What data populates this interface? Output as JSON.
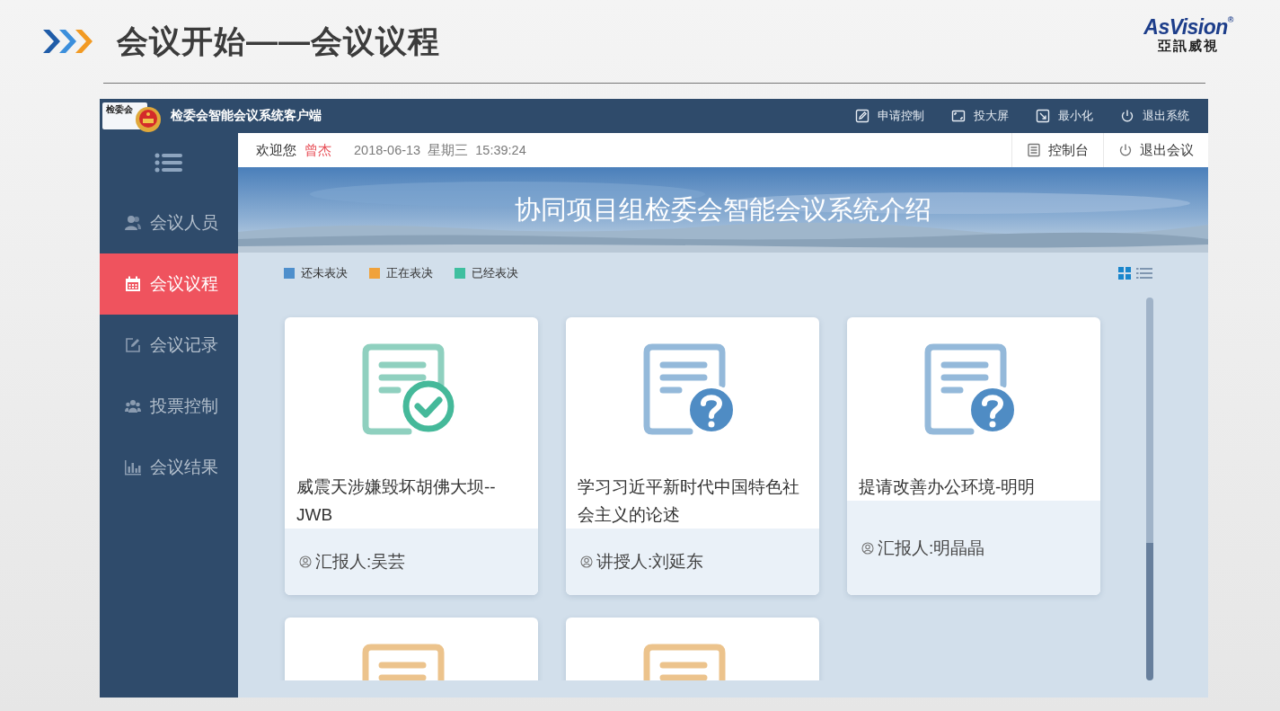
{
  "slide": {
    "title": "会议开始——会议议程",
    "logo": {
      "name": "AsVision",
      "mark": "®",
      "subtitle": "亞訊威視"
    }
  },
  "window": {
    "badge": "检委会",
    "title": "检委会智能会议系统客户端",
    "actions": [
      {
        "kind": "edit",
        "label": "申请控制"
      },
      {
        "kind": "screen",
        "label": "投大屏"
      },
      {
        "kind": "minimize",
        "label": "最小化"
      },
      {
        "kind": "power",
        "label": "退出系统"
      }
    ]
  },
  "sidebar": {
    "items": [
      {
        "kind": "people",
        "label": "会议人员",
        "selected": false
      },
      {
        "kind": "calendar",
        "label": "会议议程",
        "selected": true
      },
      {
        "kind": "edit",
        "label": "会议记录",
        "selected": false
      },
      {
        "kind": "group",
        "label": "投票控制",
        "selected": false
      },
      {
        "kind": "chart",
        "label": "会议结果",
        "selected": false
      }
    ]
  },
  "subbar": {
    "welcome": "欢迎您",
    "user": "曾杰",
    "datetime": "2018-06-13  星期三  15:39:24",
    "actions": [
      {
        "kind": "console",
        "label": "控制台"
      },
      {
        "kind": "power",
        "label": "退出会议"
      }
    ]
  },
  "banner": {
    "title": "协同项目组检委会智能会议系统介绍"
  },
  "legend": [
    {
      "label": "还未表决",
      "color": "#4e8fcc"
    },
    {
      "label": "正在表决",
      "color": "#f0a23b"
    },
    {
      "label": "已经表决",
      "color": "#3fbf9f"
    }
  ],
  "view_toggle": [
    {
      "kind": "grid",
      "selected": true
    },
    {
      "kind": "list",
      "selected": false
    }
  ],
  "cards": [
    {
      "kind": "done",
      "title": "威震天涉嫌毁坏胡佛大坝--JWB",
      "presenter": "汇报人:吴芸"
    },
    {
      "kind": "pending",
      "title": "学习习近平新时代中国特色社会主义的论述",
      "presenter": "讲授人:刘延东"
    },
    {
      "kind": "pending",
      "title": "提请改善办公环境-明明",
      "presenter": "汇报人:明晶晶"
    },
    {
      "kind": "active"
    },
    {
      "kind": "active"
    }
  ]
}
